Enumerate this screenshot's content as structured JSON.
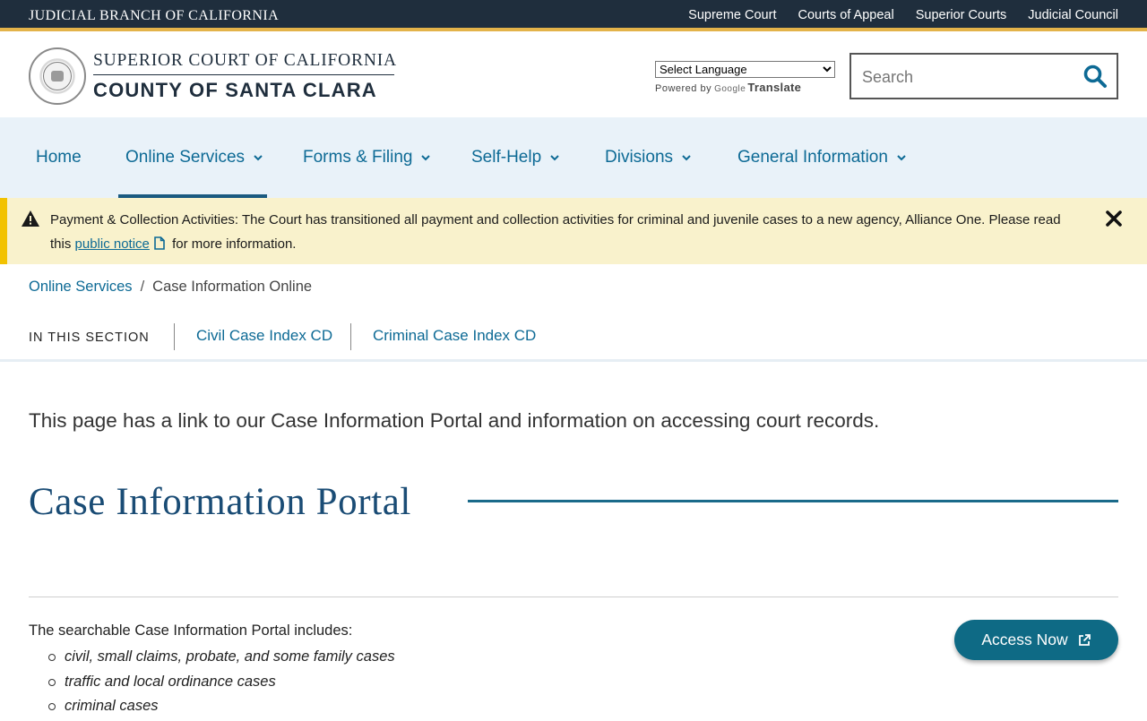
{
  "topbar": {
    "brand": "JUDICIAL BRANCH OF CALIFORNIA",
    "links": [
      "Supreme Court",
      "Courts of Appeal",
      "Superior Courts",
      "Judicial Council"
    ]
  },
  "header": {
    "court_line1": "SUPERIOR COURT OF CALIFORNIA",
    "court_line2": "COUNTY OF SANTA CLARA",
    "translate_select": "Select Language",
    "powered_by": "Powered by",
    "google_label": "Google",
    "translate_label": "Translate",
    "search_placeholder": "Search"
  },
  "nav": {
    "items": [
      "Home",
      "Online Services",
      "Forms & Filing",
      "Self-Help",
      "Divisions",
      "General Information"
    ],
    "active": "Online Services"
  },
  "alert": {
    "title": "Payment & Collection Activities:",
    "body": "The Court has transitioned all payment and collection activities for criminal and juvenile cases to a new agency, Alliance One. Please read this",
    "link": "public notice",
    "tail": "for more information."
  },
  "breadcrumb": {
    "parent": "Online Services",
    "separator": "/",
    "current": "Case Information Online"
  },
  "section_nav": {
    "label": "IN THIS SECTION",
    "links": [
      "Civil Case Index CD",
      "Criminal Case Index CD"
    ]
  },
  "content": {
    "intro": "This page has a link to our Case Information Portal and information on accessing court records.",
    "heading": "Case Information Portal",
    "portal_text": "The searchable Case Information Portal includes:",
    "portal_items": [
      " civil, small claims, probate, and some family cases",
      "traffic and local ordinance cases",
      "criminal cases"
    ],
    "access_button": "Access Now"
  },
  "colors": {
    "topbar": "#1f2e3d",
    "accent_gold": "#e3b34a",
    "link": "#0d6a95",
    "heading": "#1a4c75",
    "nav_bg": "#e9f2f9",
    "alert_bg": "#f9f2cc",
    "button": "#0e6a85"
  },
  "icons": {
    "seal": "court-seal-icon",
    "search": "search-icon",
    "chevron": "chevron-down-icon",
    "warning": "warning-triangle-icon",
    "close": "close-icon",
    "document": "document-icon",
    "external": "external-link-icon"
  }
}
